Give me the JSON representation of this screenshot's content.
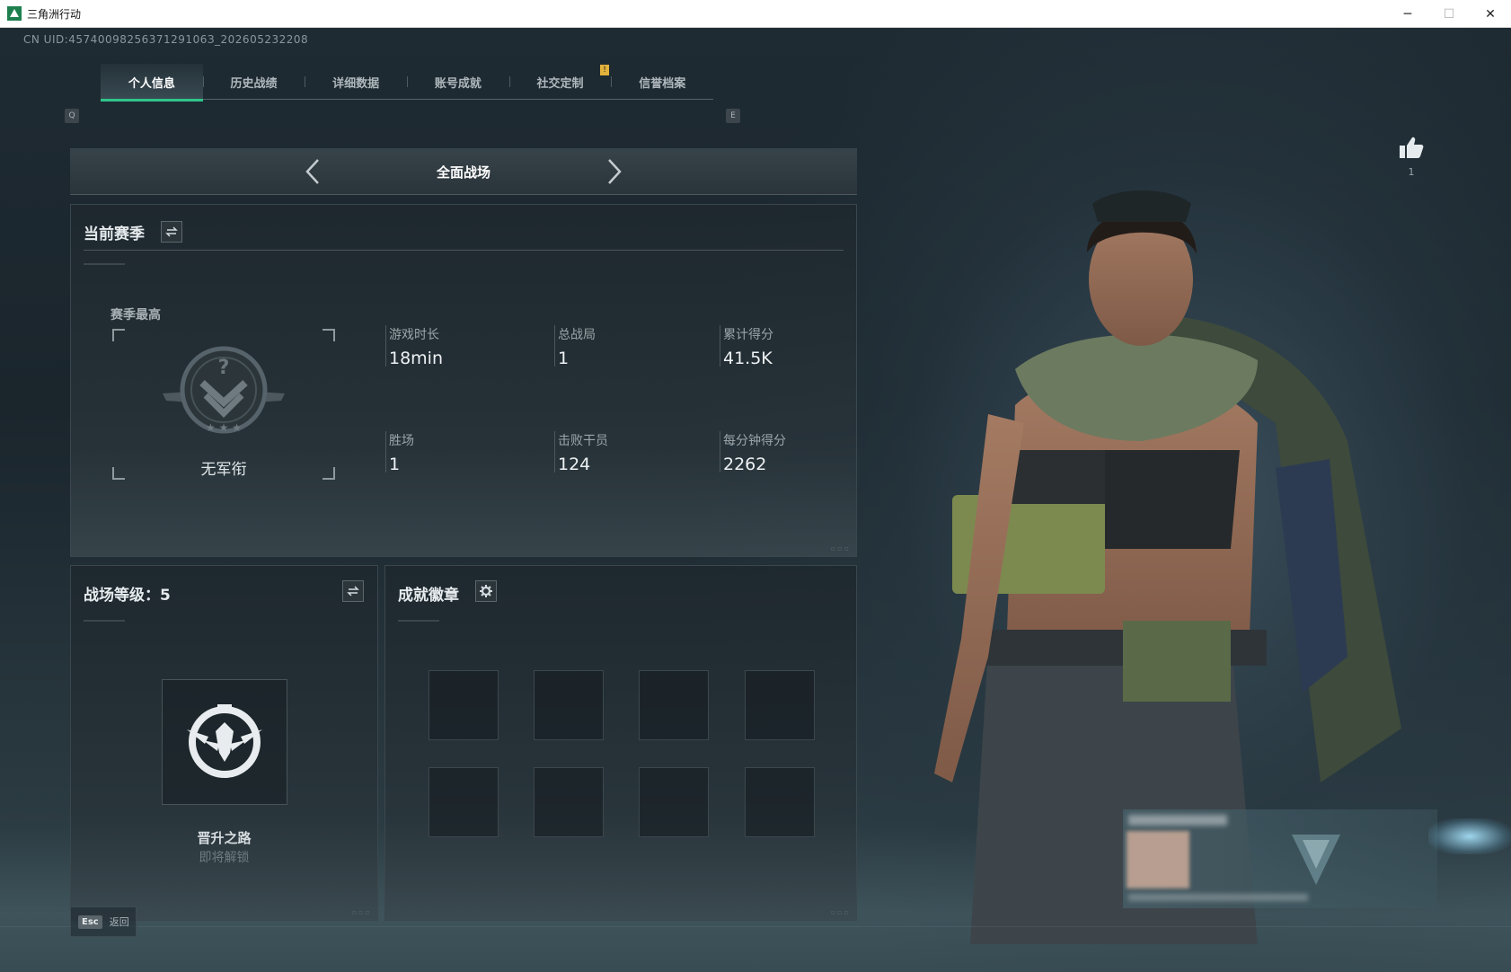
{
  "window": {
    "title": "三角洲行动",
    "controls": {
      "minimize": "─",
      "maximize": "☐",
      "close": "✕"
    }
  },
  "uid": "CN UID:4574009825637129106З_202605232208",
  "tabs": {
    "prev_key": "Q",
    "next_key": "E",
    "items": [
      {
        "label": "个人信息",
        "active": true
      },
      {
        "label": "历史战绩",
        "active": false
      },
      {
        "label": "详细数据",
        "active": false
      },
      {
        "label": "账号成就",
        "active": false
      },
      {
        "label": "社交定制",
        "active": false
      },
      {
        "label": "信誉档案",
        "active": false
      }
    ],
    "notice_badge": "!"
  },
  "mode": {
    "label": "全面战场",
    "prev_icon": "chevron-left-icon",
    "next_icon": "chevron-right-icon"
  },
  "season": {
    "title": "当前赛季",
    "best_label": "赛季最高",
    "rank_name": "无军衔",
    "stats": [
      {
        "label": "游戏时长",
        "value": "18min"
      },
      {
        "label": "总战局",
        "value": "1"
      },
      {
        "label": "累计得分",
        "value": "41.5K"
      },
      {
        "label": "胜场",
        "value": "1"
      },
      {
        "label": "击败干员",
        "value": "124"
      },
      {
        "label": "每分钟得分",
        "value": "2262"
      }
    ]
  },
  "level": {
    "title": "战场等级：5",
    "emblem_name": "晋升之路",
    "lock_text": "即将解锁"
  },
  "achievements": {
    "title": "成就徽章",
    "settings_icon": "gear-icon",
    "slots": 8
  },
  "like": {
    "count": "1",
    "icon": "thumbs-up-icon"
  },
  "footer": {
    "esc_key": "Esc",
    "esc_label": "返回"
  },
  "colors": {
    "accent": "#2fc58a",
    "notice": "#e3b23c"
  }
}
